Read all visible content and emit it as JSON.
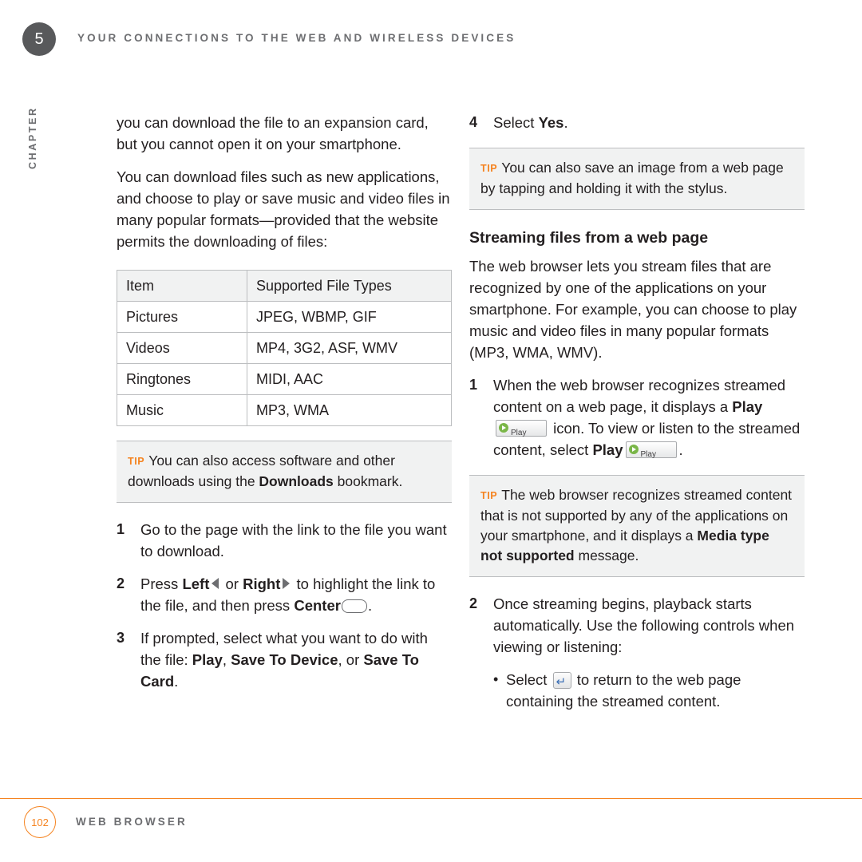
{
  "header": {
    "chapter_number": "5",
    "title": "YOUR CONNECTIONS TO THE WEB AND WIRELESS DEVICES",
    "chapter_label": "CHAPTER"
  },
  "left_column": {
    "para1": "you can download the file to an expansion card, but you cannot open it on your smartphone.",
    "para2": "You can download files such as new applications, and choose to play or save music and video files in many popular formats—provided that the website permits the downloading of files:",
    "table": {
      "headers": [
        "Item",
        "Supported File Types"
      ],
      "rows": [
        [
          "Pictures",
          "JPEG, WBMP, GIF"
        ],
        [
          "Videos",
          "MP4, 3G2, ASF, WMV"
        ],
        [
          "Ringtones",
          "MIDI, AAC"
        ],
        [
          "Music",
          "MP3, WMA"
        ]
      ]
    },
    "tip": {
      "label": "TIP",
      "text_a": "You can also access software and other downloads using the ",
      "bold": "Downloads",
      "text_b": " bookmark."
    },
    "steps": [
      {
        "num": "1",
        "text": "Go to the page with the link to the file you want to download."
      },
      {
        "num": "2",
        "text_a": "Press ",
        "bold_a": "Left",
        "text_b": " or ",
        "bold_b": "Right",
        "text_c": " to highlight the link to the file, and then press ",
        "bold_c": "Center",
        "text_d": "."
      },
      {
        "num": "3",
        "text_a": "If prompted, select what you want to do with the file: ",
        "bold_a": "Play",
        "text_b": ", ",
        "bold_b": "Save To Device",
        "text_c": ", or ",
        "bold_c": "Save To Card",
        "text_d": "."
      }
    ]
  },
  "right_column": {
    "step4": {
      "num": "4",
      "text_a": "Select ",
      "bold": "Yes",
      "text_b": "."
    },
    "tip1": {
      "label": "TIP",
      "text": "You can also save an image from a web page by tapping and holding it with the stylus."
    },
    "section_heading": "Streaming files from a web page",
    "para1": "The web browser lets you stream files that are recognized by one of the applications on your smartphone. For example, you can choose to play music and video files in many popular formats (MP3, WMA, WMV).",
    "step1": {
      "num": "1",
      "text_a": "When the web browser recognizes streamed content on a web page, it displays a ",
      "bold_a": "Play",
      "play_icon_label": "Play",
      "text_b": " icon. To view or listen to the streamed content, select ",
      "bold_b": "Play",
      "text_c": "."
    },
    "tip2": {
      "label": "TIP",
      "text_a": "The web browser recognizes streamed content that is not supported by any of the applications on your smartphone, and it displays a ",
      "bold": "Media type not supported",
      "text_b": " message."
    },
    "step2": {
      "num": "2",
      "text": "Once streaming begins, playback starts automatically. Use the following controls when viewing or listening:",
      "bullet_a": "Select ",
      "bullet_b": " to return to the web page containing the streamed content."
    }
  },
  "footer": {
    "page_number": "102",
    "title": "WEB BROWSER"
  },
  "colors": {
    "accent": "#f5831f",
    "gray": "#6d6e71",
    "badge": "#58595b",
    "rule": "#bcbec0",
    "play_green": "#7ab648"
  }
}
